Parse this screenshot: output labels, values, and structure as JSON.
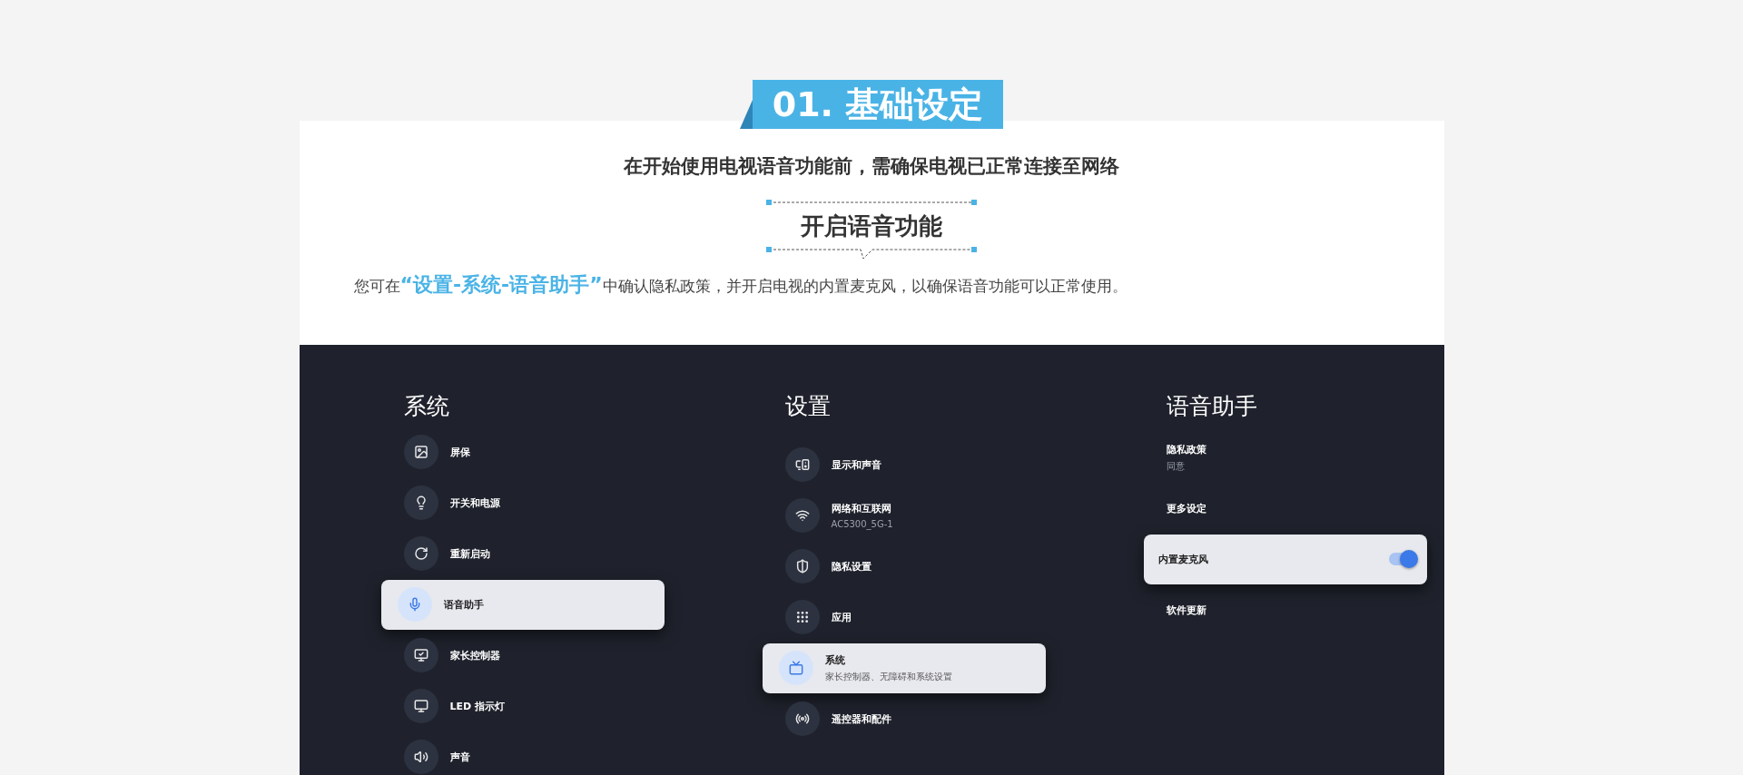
{
  "badge": {
    "title": "01. 基础设定"
  },
  "subtitle": "在开始使用电视语音功能前，需确保电视已正常连接至网络",
  "section_title": "开启语音功能",
  "intro": {
    "before": "您可在",
    "highlight": "“设置-系统-语音助手”",
    "after": "中确认隐私政策，并开启电视的内置麦克风，以确保语音功能可以正常使用。"
  },
  "screen": {
    "columns": [
      {
        "title": "系统",
        "items": [
          {
            "kind": "icon",
            "label": "屏保",
            "selected": false
          },
          {
            "kind": "icon",
            "label": "开关和电源",
            "selected": false
          },
          {
            "kind": "icon",
            "label": "重新启动",
            "selected": false
          },
          {
            "kind": "icon",
            "label": "语音助手",
            "selected": true
          },
          {
            "kind": "icon",
            "label": "家长控制器",
            "selected": false
          },
          {
            "kind": "icon",
            "label": "LED 指示灯",
            "selected": false
          },
          {
            "kind": "icon",
            "label": "声音",
            "selected": false
          }
        ]
      },
      {
        "title": "设置",
        "items": [
          {
            "kind": "icon",
            "label": "显示和声音",
            "selected": false
          },
          {
            "kind": "icon",
            "label": "网络和互联网",
            "detail": "AC5300_5G-1",
            "selected": false
          },
          {
            "kind": "icon",
            "label": "隐私设置",
            "selected": false
          },
          {
            "kind": "icon",
            "label": "应用",
            "selected": false
          },
          {
            "kind": "icon",
            "label": "系统",
            "detail": "家长控制器、无障碍和系统设置",
            "selected": true
          },
          {
            "kind": "icon",
            "label": "遥控器和配件",
            "selected": false
          }
        ]
      },
      {
        "title": "语音助手",
        "items": [
          {
            "kind": "text",
            "label": "隐私政策",
            "detail": "同意",
            "selected": false
          },
          {
            "kind": "text",
            "label": "更多设定",
            "selected": false
          },
          {
            "kind": "toggle",
            "label": "内置麦克风",
            "on": true,
            "selected": true
          },
          {
            "kind": "text",
            "label": "软件更新",
            "selected": false
          }
        ]
      }
    ]
  }
}
